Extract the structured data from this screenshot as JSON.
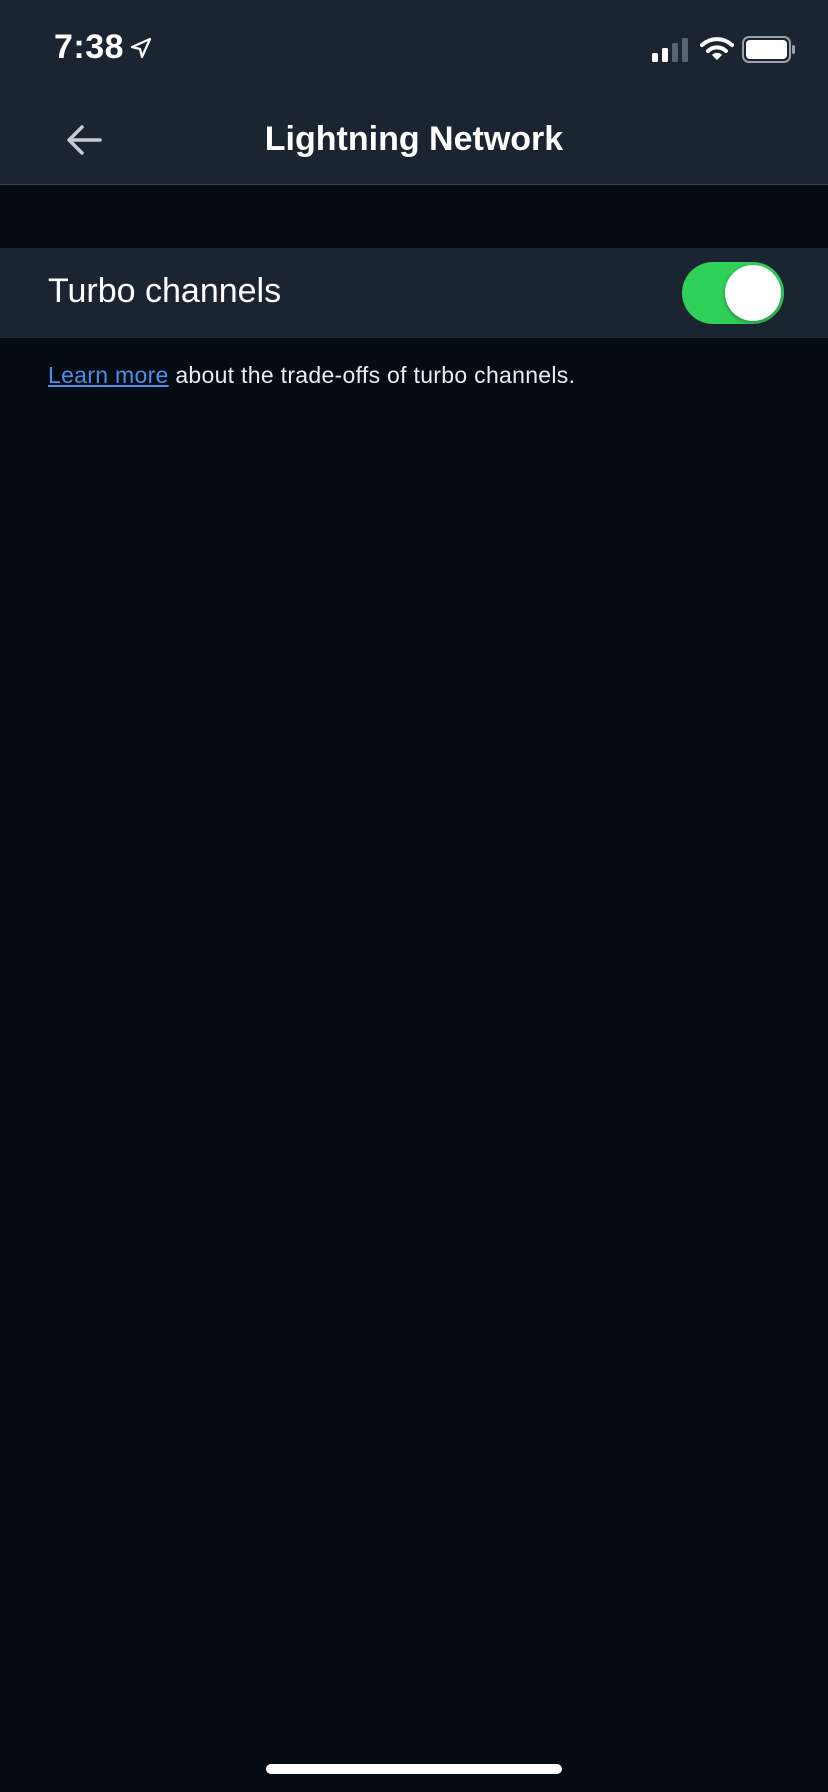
{
  "status_bar": {
    "time": "7:38",
    "icons": [
      "location-arrow-icon",
      "signal-icon",
      "wifi-icon",
      "battery-icon"
    ]
  },
  "nav": {
    "title": "Lightning Network",
    "back_icon": "arrow-left-icon"
  },
  "settings": {
    "turbo_channels": {
      "label": "Turbo channels",
      "enabled": true
    }
  },
  "footnote": {
    "link_text": "Learn more",
    "text": " about the trade-offs of turbo channels."
  },
  "colors": {
    "background": "#050b13",
    "bar_background": "#1b2531",
    "toggle_on": "#30d158",
    "link": "#4b8fe8"
  }
}
